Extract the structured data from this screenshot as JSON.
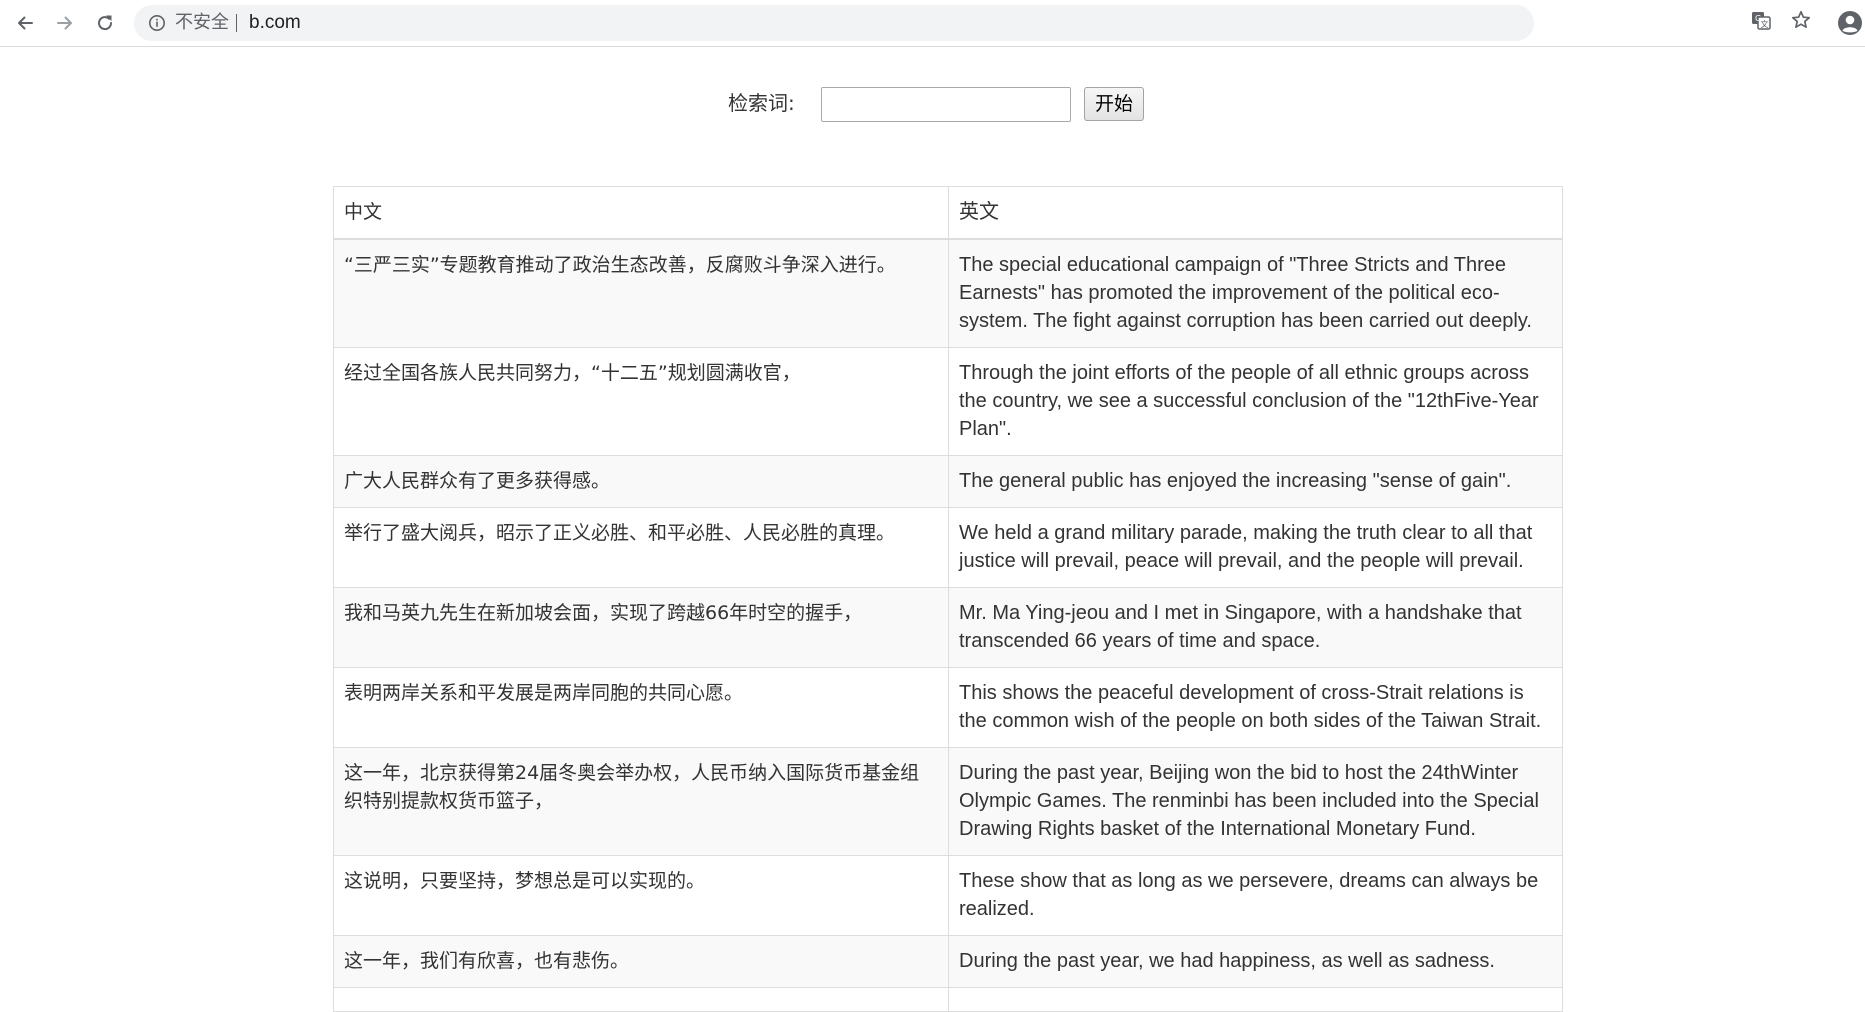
{
  "browser": {
    "security_text": "不安全",
    "url": "b.com",
    "icons": {
      "back": "arrow-left-icon",
      "forward": "arrow-right-icon",
      "reload": "reload-icon",
      "info": "info-icon",
      "translate": "translate-icon",
      "bookmark": "star-icon",
      "account": "account-icon"
    }
  },
  "search": {
    "label": "检索词:",
    "input_value": "",
    "placeholder": "",
    "button_label": "开始"
  },
  "table": {
    "headers": [
      "中文",
      "英文"
    ],
    "rows": [
      {
        "zh": "“三严三实”专题教育推动了政治生态改善，反腐败斗争深入进行。",
        "en": "The special educational campaign of \"Three Stricts and Three Earnests\" has promoted the improvement of the political eco-system. The fight against corruption has been carried out deeply."
      },
      {
        "zh": "经过全国各族人民共同努力，“十二五”规划圆满收官，",
        "en": "Through the joint efforts of the people of all ethnic groups across the country, we see a successful conclusion of the \"12thFive-Year Plan\"."
      },
      {
        "zh": "广大人民群众有了更多获得感。",
        "en": "The general public has enjoyed the increasing \"sense of gain\"."
      },
      {
        "zh": "举行了盛大阅兵，昭示了正义必胜、和平必胜、人民必胜的真理。",
        "en": "We held a grand military parade, making the truth clear to all that justice will prevail, peace will prevail, and the people will prevail."
      },
      {
        "zh": "我和马英九先生在新加坡会面，实现了跨越66年时空的握手，",
        "en": "Mr. Ma Ying-jeou and I met in Singapore, with a handshake that transcended 66 years of time and space."
      },
      {
        "zh": "表明两岸关系和平发展是两岸同胞的共同心愿。",
        "en": "This shows the peaceful development of cross-Strait relations is the common wish of the people on both sides of the Taiwan Strait."
      },
      {
        "zh": "这一年，北京获得第24届冬奥会举办权，人民币纳入国际货币基金组织特别提款权货币篮子，",
        "en": "During the past year, Beijing won the bid to host the 24thWinter Olympic Games. The renminbi has been included into the Special Drawing Rights basket of the International Monetary Fund."
      },
      {
        "zh": "这说明，只要坚持，梦想总是可以实现的。",
        "en": "These show that as long as we persevere, dreams can always be realized."
      },
      {
        "zh": "这一年，我们有欣喜，也有悲伤。",
        "en": "During the past year, we had happiness, as well as sadness."
      },
      {
        "zh": "",
        "en": ""
      }
    ]
  }
}
